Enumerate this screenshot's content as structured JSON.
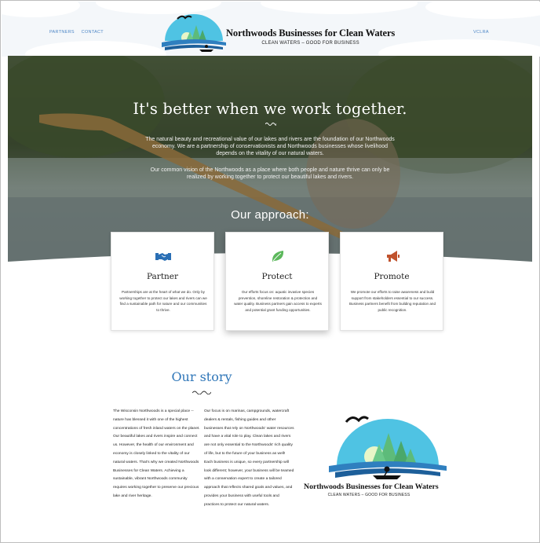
{
  "nav": {
    "left_items": [
      "PARTNERS",
      "CONTACT"
    ],
    "right_item": "VCLRA"
  },
  "brand": {
    "name": "Northwoods Businesses for Clean Waters",
    "tagline": "CLEAN WATERS – GOOD FOR BUSINESS"
  },
  "hero": {
    "title": "It's better when we work together.",
    "paragraph1": "The natural beauty and recreational value of our lakes and rivers are the foundation of our Northwoods economy. We are a partnership of conservationists and Northwoods businesses whose livelihood depends on the vitality of our natural waters.",
    "paragraph2": "Our common vision of the Northwoods as a place where both people and nature thrive can only be realized by working together to protect our beautiful lakes and rivers.",
    "approach_heading": "Our approach:"
  },
  "cards": [
    {
      "icon": "handshake-icon",
      "color": "#2a6fb5",
      "title": "Partner",
      "text": "Partnerships are at the heart of what we do. Only by working together to protect our lakes and rivers can we find a sustainable path for nature and our communities to thrive."
    },
    {
      "icon": "leaf-icon",
      "color": "#5cb85c",
      "title": "Protect",
      "text": "Our efforts focus on: aquatic invasive species prevention, shoreline restoration & protection and water quality. Business partners gain access to experts and potential grant funding opportunities."
    },
    {
      "icon": "megaphone-icon",
      "color": "#c0522d",
      "title": "Promote",
      "text": "We promote our efforts to raise awareness and build support from stakeholders essential to our success. Business partners benefit from building reputation and public recognition."
    }
  ],
  "story": {
    "title": "Our story",
    "col1_text": "The Wisconsin Northwoods is a special place -- nature has blessed it with one of the highest concentrations of fresh inland waters on the planet.  Our beautiful lakes and rivers inspire and connect us. However, the health of our environment and economy is closely linked to the vitality of our natural waters.  That's why we created Northwoods Businesses for Clean Waters.  Achieving a sustainable, vibrant Northwoods community requires working together to preserve our precious lake and river heritage.",
    "col2_text": "Our focus is on marinas, campgrounds, watercraft dealers & rentals, fishing guides and other businesses that rely on Northwoods' water resources and have a vital role to play. Clean lakes and rivers are not only essential to the Northwoods' rich quality of life, but to the future of your business as well!  Each business is unique, so every partnership will look different;  however, your business will be teamed with a conservation expert to create a tailored approach that reflects shared goals and values, and provides your business with useful tools and practices to protect our natural waters."
  },
  "colors": {
    "link": "#4d86c6",
    "story_title": "#2f76b8",
    "logo_sky": "#4fc3e3"
  }
}
